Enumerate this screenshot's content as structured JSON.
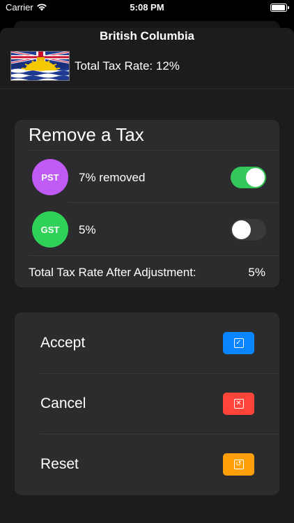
{
  "status_bar": {
    "carrier": "Carrier",
    "time": "5:08 PM"
  },
  "header": {
    "title": "British Columbia",
    "total_rate_label": "Total Tax Rate: 12%"
  },
  "remove_tax": {
    "title": "Remove a Tax",
    "taxes": [
      {
        "code": "PST",
        "rate_text": "7%  removed",
        "enabled": true,
        "color": "#bf5af2"
      },
      {
        "code": "GST",
        "rate_text": "5%",
        "enabled": false,
        "color": "#30d158"
      }
    ],
    "after_label": "Total Tax Rate After Adjustment:",
    "after_value": "5%"
  },
  "actions": [
    {
      "label": "Accept",
      "icon": "checkmark-icon",
      "color": "#0a84ff",
      "glyph": "✓"
    },
    {
      "label": "Cancel",
      "icon": "x-mark-icon",
      "color": "#ff453a",
      "glyph": "✕"
    },
    {
      "label": "Reset",
      "icon": "undo-icon",
      "color": "#ff9f0a",
      "glyph": "↺"
    }
  ],
  "colors": {
    "toggle_on": "#34c759",
    "card": "#2c2c2e",
    "sheet": "#1c1c1e"
  }
}
